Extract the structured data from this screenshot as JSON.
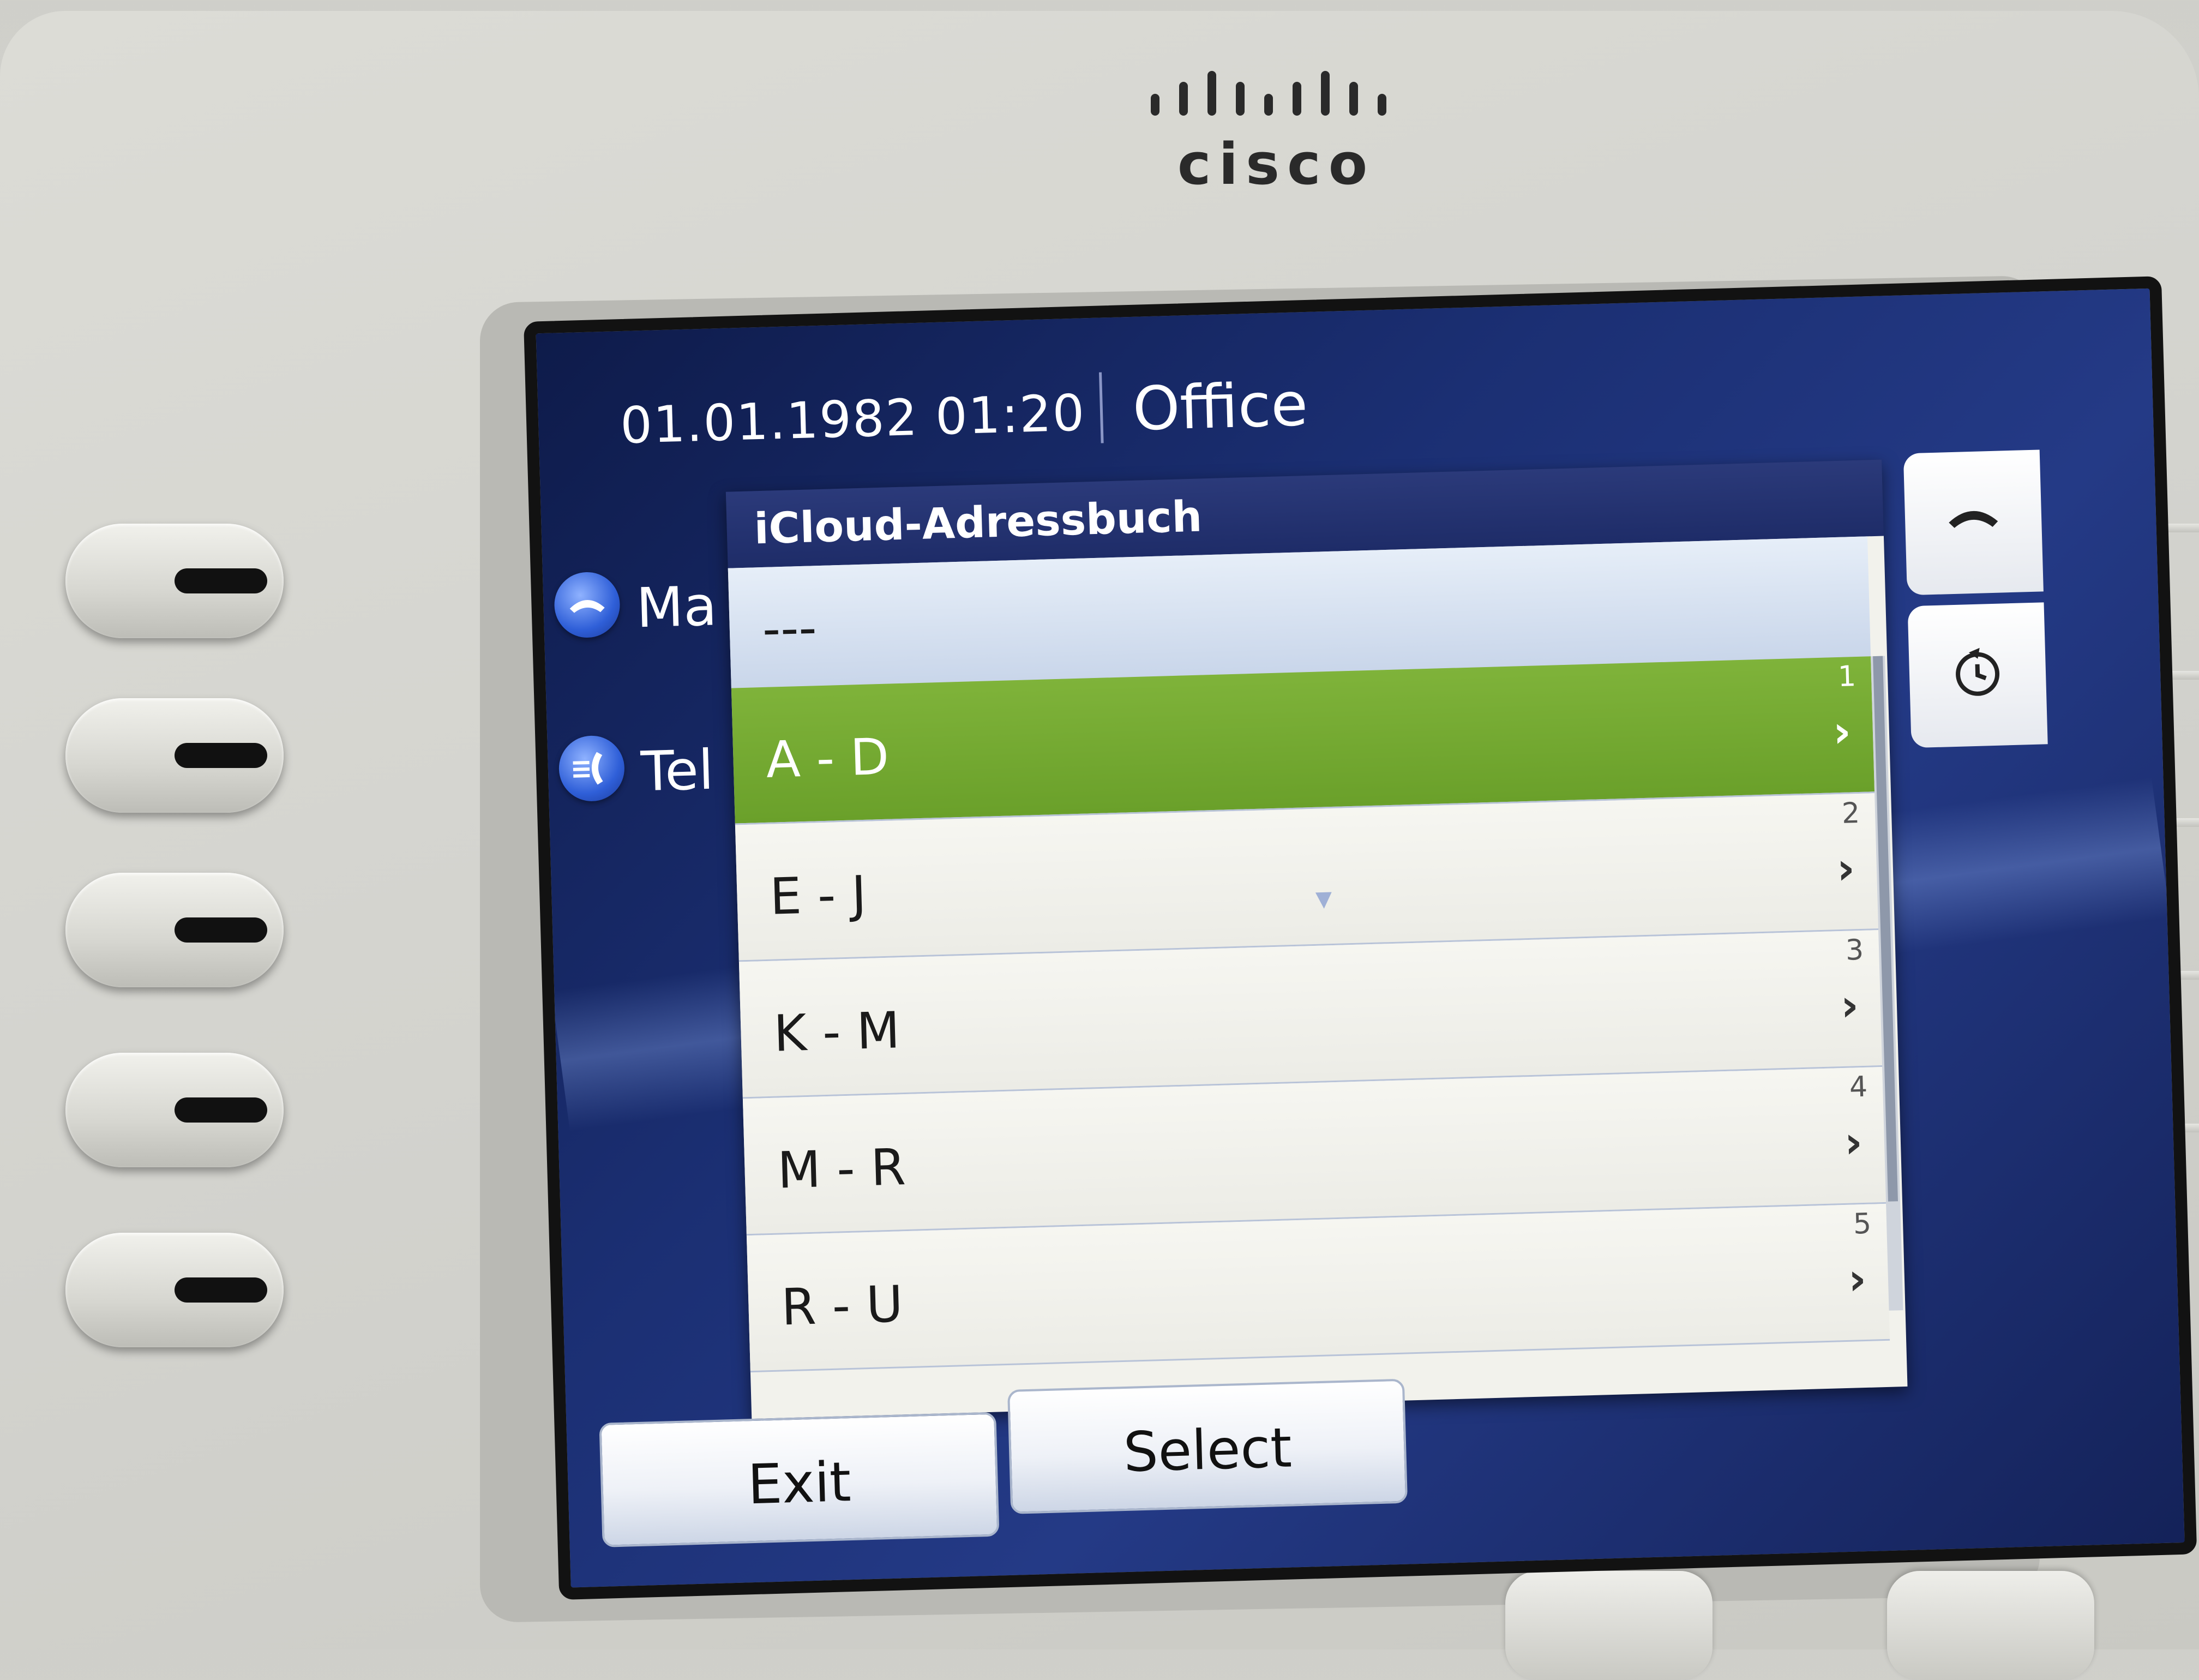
{
  "brand": {
    "name": "cisco"
  },
  "status": {
    "datetime": "01.01.1982 01:20",
    "label": "Office"
  },
  "lines": [
    {
      "label": "Ma",
      "icon": "handset-icon"
    },
    {
      "label": "Tel",
      "icon": "phone-ringing-icon"
    }
  ],
  "popup": {
    "title": "iCloud-Adressbuch",
    "header_item": "---",
    "items": [
      {
        "label": "A - D",
        "index": "1",
        "selected": true
      },
      {
        "label": "E - J",
        "index": "2",
        "selected": false
      },
      {
        "label": "K - M",
        "index": "3",
        "selected": false
      },
      {
        "label": "M - R",
        "index": "4",
        "selected": false
      },
      {
        "label": "R - U",
        "index": "5",
        "selected": false
      }
    ]
  },
  "softkeys": {
    "exit": "Exit",
    "select": "Select"
  },
  "side_buttons": [
    {
      "icon": "end-call-icon"
    },
    {
      "icon": "back-icon"
    }
  ],
  "colors": {
    "selected_row": "#6aa02a",
    "screen_bg": "#1b2f73"
  }
}
